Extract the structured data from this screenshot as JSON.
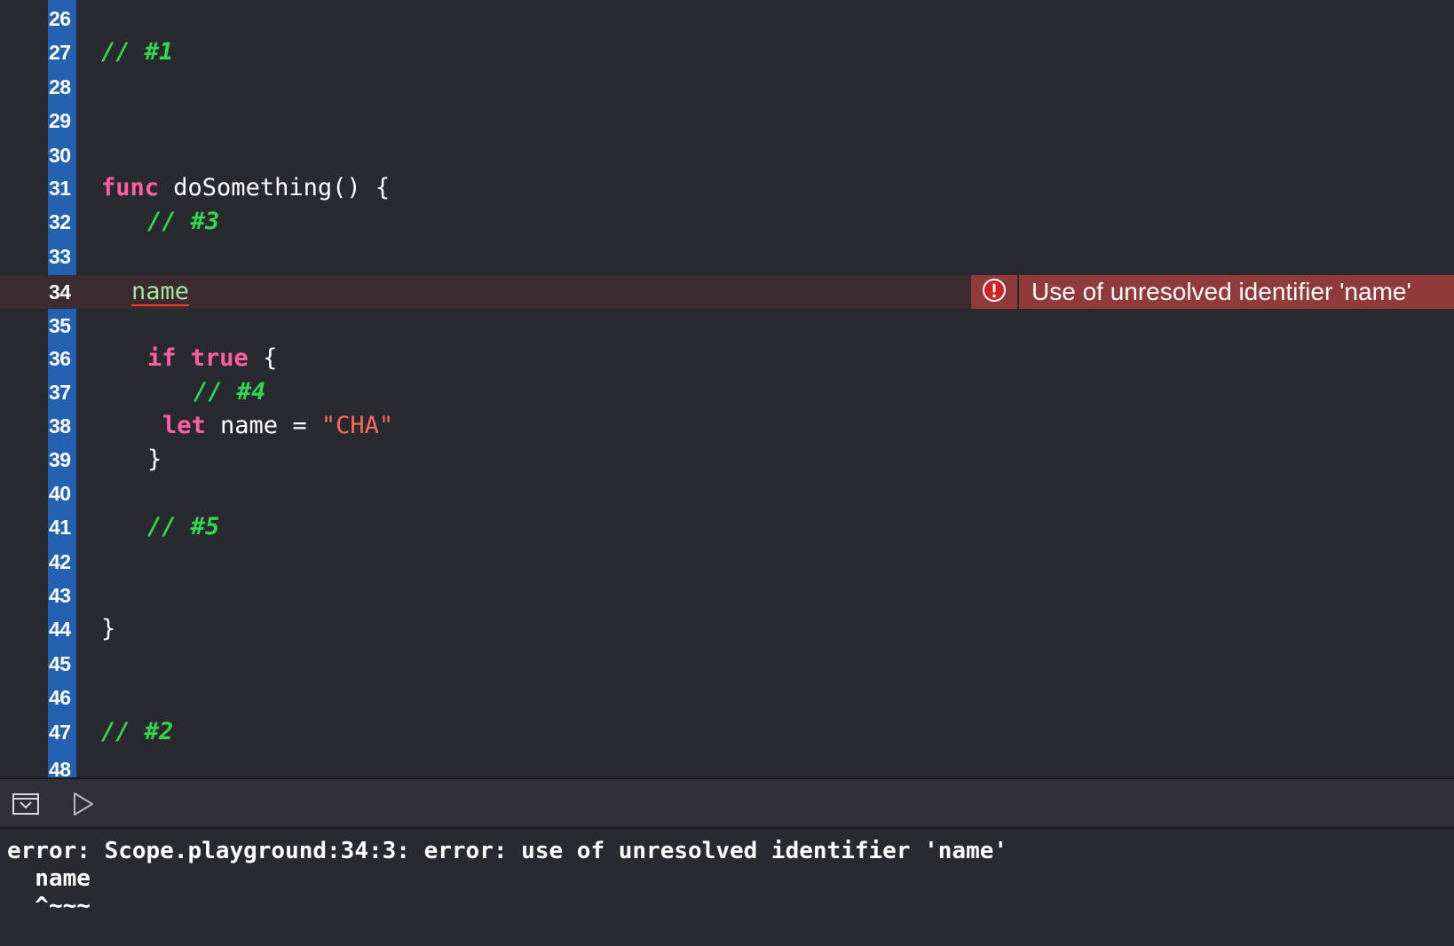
{
  "editor": {
    "lines": [
      {
        "num": "26",
        "text": ""
      },
      {
        "num": "27",
        "text": "// #1"
      },
      {
        "num": "28",
        "text": ""
      },
      {
        "num": "29",
        "text": ""
      },
      {
        "num": "30",
        "text": ""
      },
      {
        "num": "31",
        "keyword": "func",
        "text": " doSomething() {"
      },
      {
        "num": "32",
        "text": "// #3"
      },
      {
        "num": "33",
        "text": ""
      },
      {
        "num": "34",
        "text": "name"
      },
      {
        "num": "35",
        "text": ""
      },
      {
        "num": "36",
        "keyword": "if",
        "keyword2": "true",
        "text": " {"
      },
      {
        "num": "37",
        "text": "// #4"
      },
      {
        "num": "38",
        "keyword": "let",
        "text": " name = ",
        "string": "\"CHA\""
      },
      {
        "num": "39",
        "text": "}"
      },
      {
        "num": "40",
        "text": ""
      },
      {
        "num": "41",
        "text": "// #5"
      },
      {
        "num": "42",
        "text": ""
      },
      {
        "num": "43",
        "text": ""
      },
      {
        "num": "44",
        "text": "}"
      },
      {
        "num": "45",
        "text": ""
      },
      {
        "num": "46",
        "text": ""
      },
      {
        "num": "47",
        "text": "// #2"
      },
      {
        "num": "48",
        "text": ""
      }
    ]
  },
  "error_banner": {
    "icon": "error-exclamation-icon",
    "message": "Use of unresolved identifier 'name'"
  },
  "debug_bar": {
    "toggle_icon": "hide-console-icon",
    "run_icon": "play-icon"
  },
  "console": {
    "lines": [
      "error: Scope.playground:34:3: error: use of unresolved identifier 'name'",
      "  name",
      "  ^~~~"
    ]
  },
  "colors": {
    "background": "#292a30",
    "gutter": "#2262b0",
    "comment": "#32d74b",
    "keyword": "#fc5fa3",
    "string": "#fc6a5d",
    "error_banner": "#913a3a",
    "error_line": "#3c2c31"
  }
}
